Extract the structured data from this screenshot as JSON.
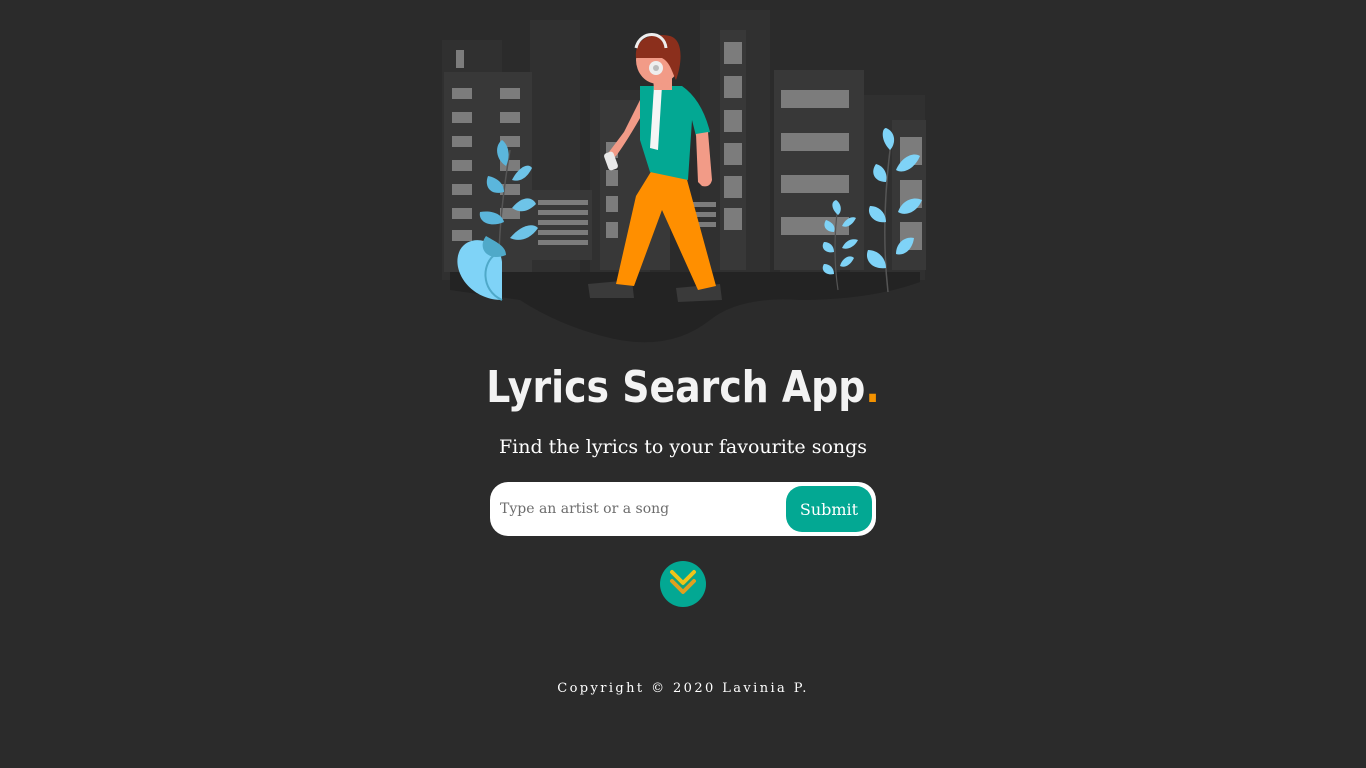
{
  "header": {
    "title": "Lyrics Search App",
    "title_dot": ".",
    "subtitle": "Find the lyrics to your favourite songs"
  },
  "search": {
    "placeholder": "Type an artist or a song",
    "value": "",
    "submit_label": "Submit"
  },
  "scroll_button": {
    "icon": "double-chevron-down-icon"
  },
  "footer": {
    "copyright": "Copyright © 2020 Lavinia P."
  },
  "colors": {
    "background": "#2b2b2b",
    "accent": "#03a893",
    "dot": "#f39200",
    "text": "#ffffff"
  }
}
